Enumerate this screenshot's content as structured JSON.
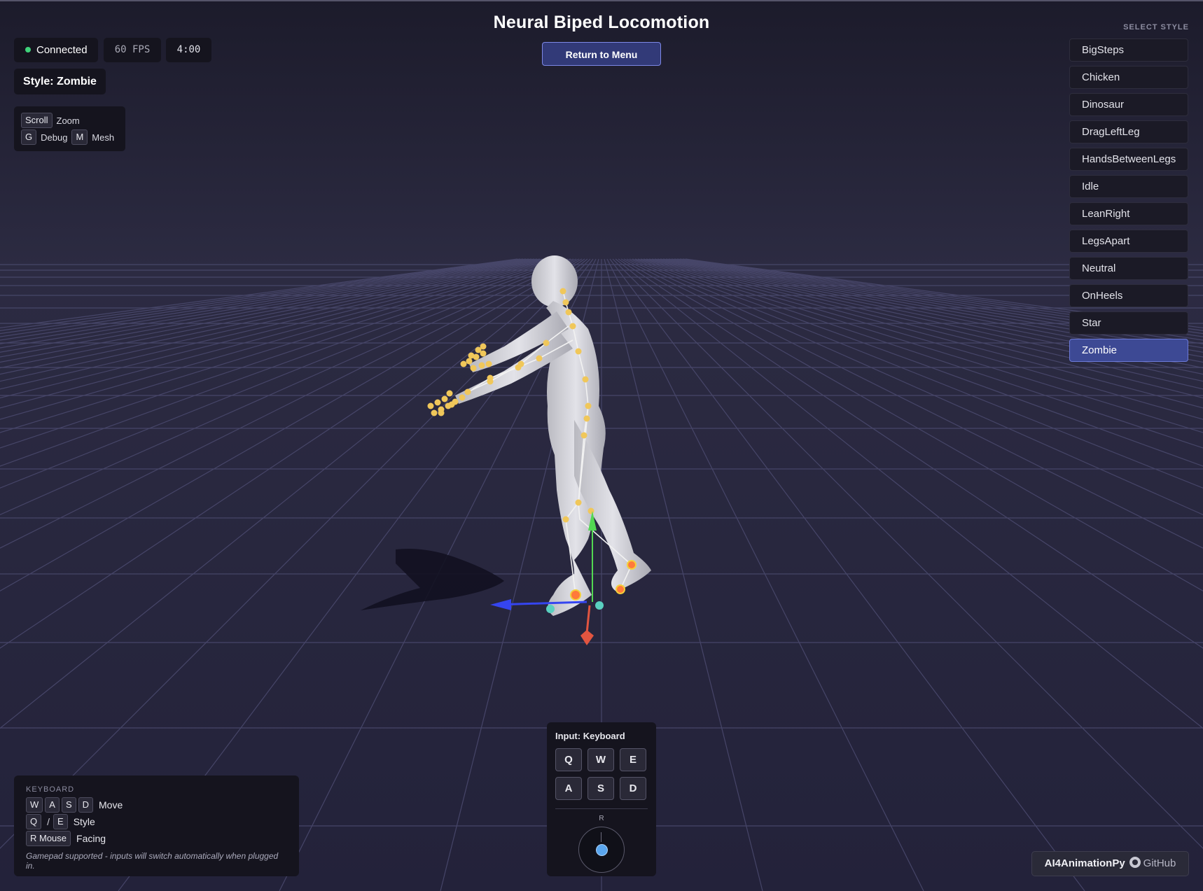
{
  "app": {
    "title": "Neural Biped Locomotion"
  },
  "header": {
    "return_label": "Return to Menu"
  },
  "status": {
    "connection": "Connected",
    "fps": "60 FPS",
    "timer": "4:00",
    "style": "Style: Zombie"
  },
  "hints": [
    {
      "key": "Scroll",
      "label": "Zoom"
    },
    {
      "key": "G",
      "label": "Debug"
    },
    {
      "key": "M",
      "label": "Mesh"
    }
  ],
  "style_panel": {
    "heading": "SELECT STYLE",
    "items": [
      "BigSteps",
      "Chicken",
      "Dinosaur",
      "DragLeftLeg",
      "HandsBetweenLegs",
      "Idle",
      "LeanRight",
      "LegsApart",
      "Neutral",
      "OnHeels",
      "Star",
      "Zombie"
    ],
    "selected": "Zombie"
  },
  "keyboard": {
    "heading": "KEYBOARD",
    "move_keys": [
      "W",
      "A",
      "S",
      "D"
    ],
    "move_label": "Move",
    "style_keys": [
      "Q",
      "E"
    ],
    "style_sep": "/",
    "style_label": "Style",
    "facing_key": "R Mouse",
    "facing_label": "Facing",
    "note": "Gamepad supported - inputs will switch automatically when plugged in."
  },
  "input_panel": {
    "title": "Input: Keyboard",
    "keys": [
      "Q",
      "W",
      "E",
      "A",
      "S",
      "D"
    ],
    "stick_label": "R"
  },
  "footer": {
    "brand": "AI4AnimationPy",
    "link": "GitHub"
  },
  "colors": {
    "accent": "#3d4994",
    "connected": "#3fd27a",
    "joint": "#f0c75a",
    "grid": "#4a4a6a"
  }
}
